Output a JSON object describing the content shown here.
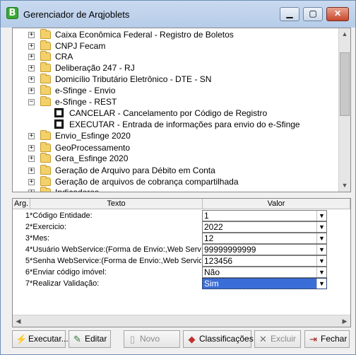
{
  "window": {
    "title": "Gerenciador de Arqjoblets",
    "app_icon_letter": "B"
  },
  "title_buttons": {
    "minimize": "▁",
    "maximize": "▢",
    "close": "✕"
  },
  "tree": {
    "items": [
      {
        "label": "Caixa Econômica Federal - Registro de Boletos",
        "type": "folder",
        "expander": "+"
      },
      {
        "label": "CNPJ Fecam",
        "type": "folder",
        "expander": "+"
      },
      {
        "label": "CRA",
        "type": "folder",
        "expander": "+"
      },
      {
        "label": "Deliberação 247 - RJ",
        "type": "folder",
        "expander": "+"
      },
      {
        "label": "Domicílio Tributário Eletrônico - DTE - SN",
        "type": "folder",
        "expander": "+"
      },
      {
        "label": "e-Sfinge - Envio",
        "type": "folder",
        "expander": "+"
      },
      {
        "label": "e-Sfinge - REST",
        "type": "folder",
        "expander": "−"
      },
      {
        "label": "CANCELAR - Cancelamento por Código de Registro",
        "type": "command"
      },
      {
        "label": "EXECUTAR - Entrada de informações para envio do e-Sfinge",
        "type": "command"
      },
      {
        "label": "Envio_Esfinge 2020",
        "type": "folder",
        "expander": "+"
      },
      {
        "label": "GeoProcessamento",
        "type": "folder",
        "expander": "+"
      },
      {
        "label": "Gera_Esfinge 2020",
        "type": "folder",
        "expander": "+"
      },
      {
        "label": "Geração de Arquivo para Débito em Conta",
        "type": "folder",
        "expander": "+"
      },
      {
        "label": "Geração de arquivos de cobrança compartilhada",
        "type": "folder",
        "expander": "+"
      },
      {
        "label": "Indicadores",
        "type": "folder",
        "expander": "+"
      }
    ]
  },
  "grid": {
    "headers": {
      "arg": "Arg.",
      "texto": "Texto",
      "valor": "Valor"
    },
    "rows": [
      {
        "num": "1",
        "texto": "*Código Entidade:",
        "valor": "1"
      },
      {
        "num": "2",
        "texto": "*Exercicio:",
        "valor": "2022"
      },
      {
        "num": "3",
        "texto": "*Mes:",
        "valor": "12"
      },
      {
        "num": "4",
        "texto": "*Usuário WebService:(Forma de Envio:,Web Servic",
        "valor": "99999999999"
      },
      {
        "num": "5",
        "texto": "*Senha WebService:(Forma de Envio:,Web Servic",
        "valor": "123456"
      },
      {
        "num": "6",
        "texto": "*Enviar código imóvel:",
        "valor": "Não"
      },
      {
        "num": "7",
        "texto": "*Realizar Validação:",
        "valor": "Sim"
      }
    ]
  },
  "toolbar": {
    "executar": "Executar...",
    "editar": "Editar",
    "novo": "Novo",
    "classificacoes": "Classificações",
    "excluir": "Excluir",
    "fechar": "Fechar"
  }
}
